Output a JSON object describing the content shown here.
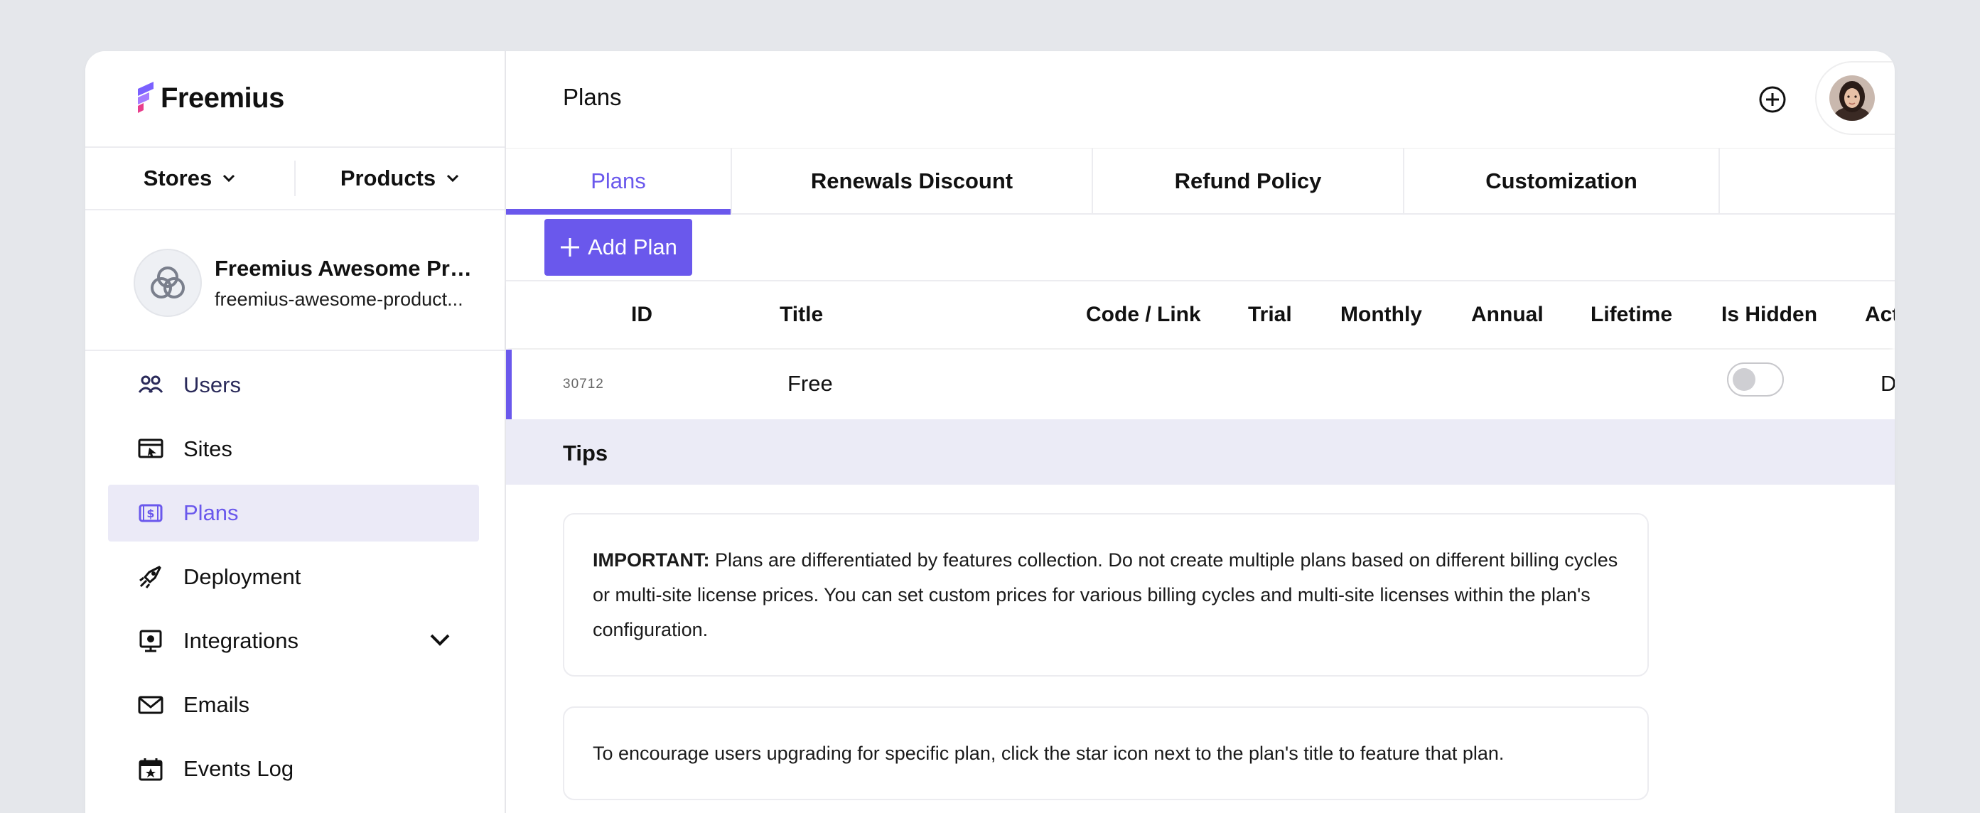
{
  "brand": {
    "name": "Freemius",
    "accent": "#6a58ec",
    "accent_secondary": "#e83e8c"
  },
  "sidebar": {
    "switchers": {
      "stores": "Stores",
      "products": "Products"
    },
    "product": {
      "name": "Freemius Awesome Pro...",
      "slug": "freemius-awesome-product..."
    },
    "items": [
      {
        "label": "Users",
        "icon": "users-icon"
      },
      {
        "label": "Sites",
        "icon": "sites-icon"
      },
      {
        "label": "Plans",
        "icon": "plans-icon",
        "active": true
      },
      {
        "label": "Deployment",
        "icon": "deployment-icon"
      },
      {
        "label": "Integrations",
        "icon": "integrations-icon",
        "expandable": true
      },
      {
        "label": "Emails",
        "icon": "email-icon"
      },
      {
        "label": "Events Log",
        "icon": "events-log-icon"
      }
    ]
  },
  "header": {
    "title": "Plans"
  },
  "tabs": [
    {
      "label": "Plans",
      "active": true
    },
    {
      "label": "Renewals Discount"
    },
    {
      "label": "Refund Policy"
    },
    {
      "label": "Customization"
    }
  ],
  "add_plan_label": "Add Plan",
  "table": {
    "columns": [
      "ID",
      "Title",
      "Code / Link",
      "Trial",
      "Monthly",
      "Annual",
      "Lifetime",
      "Is Hidden",
      "Actions"
    ],
    "rows": [
      {
        "id": "30712",
        "title": "Free",
        "is_hidden": false,
        "action": "Delete"
      }
    ]
  },
  "tips": {
    "title": "Tips",
    "items": [
      {
        "strong": "IMPORTANT:",
        "text": " Plans are differentiated by features collection. Do not create multiple plans based on different billing cycles or multi-site license prices. You can set custom prices for various billing cycles and multi-site licenses within the plan's configuration."
      },
      {
        "text": "To encourage users upgrading for specific plan, click the star icon next to the plan's title to feature that plan."
      }
    ]
  }
}
